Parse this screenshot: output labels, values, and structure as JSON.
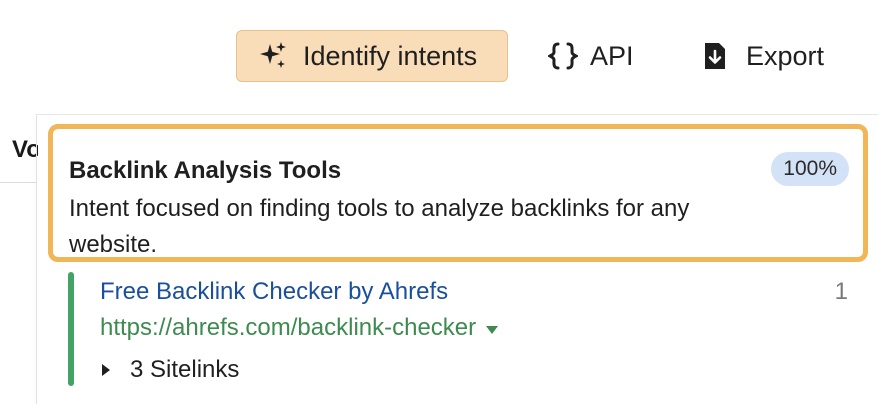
{
  "toolbar": {
    "identify_intents": {
      "label": "Identify intents",
      "icon": "sparkles-icon"
    },
    "api": {
      "label": "API",
      "icon": "braces-icon"
    },
    "export": {
      "label": "Export",
      "icon": "download-icon"
    }
  },
  "table": {
    "column_header_partial": "Vo"
  },
  "intent": {
    "title": "Backlink Analysis Tools",
    "description": "Intent focused on finding tools to analyze backlinks for any website.",
    "percentage": "100%"
  },
  "result": {
    "title": "Free Backlink Checker by Ahrefs",
    "url": "https://ahrefs.com/backlink-checker",
    "position": "1",
    "sitelinks": "3 Sitelinks"
  },
  "colors": {
    "intent_button_bg": "#f9dcb8",
    "card_border": "#f1b657",
    "badge_bg": "#d3e2f6",
    "link_blue": "#1a4f9c",
    "url_green": "#3d8b4f",
    "result_bar": "#42a364"
  }
}
